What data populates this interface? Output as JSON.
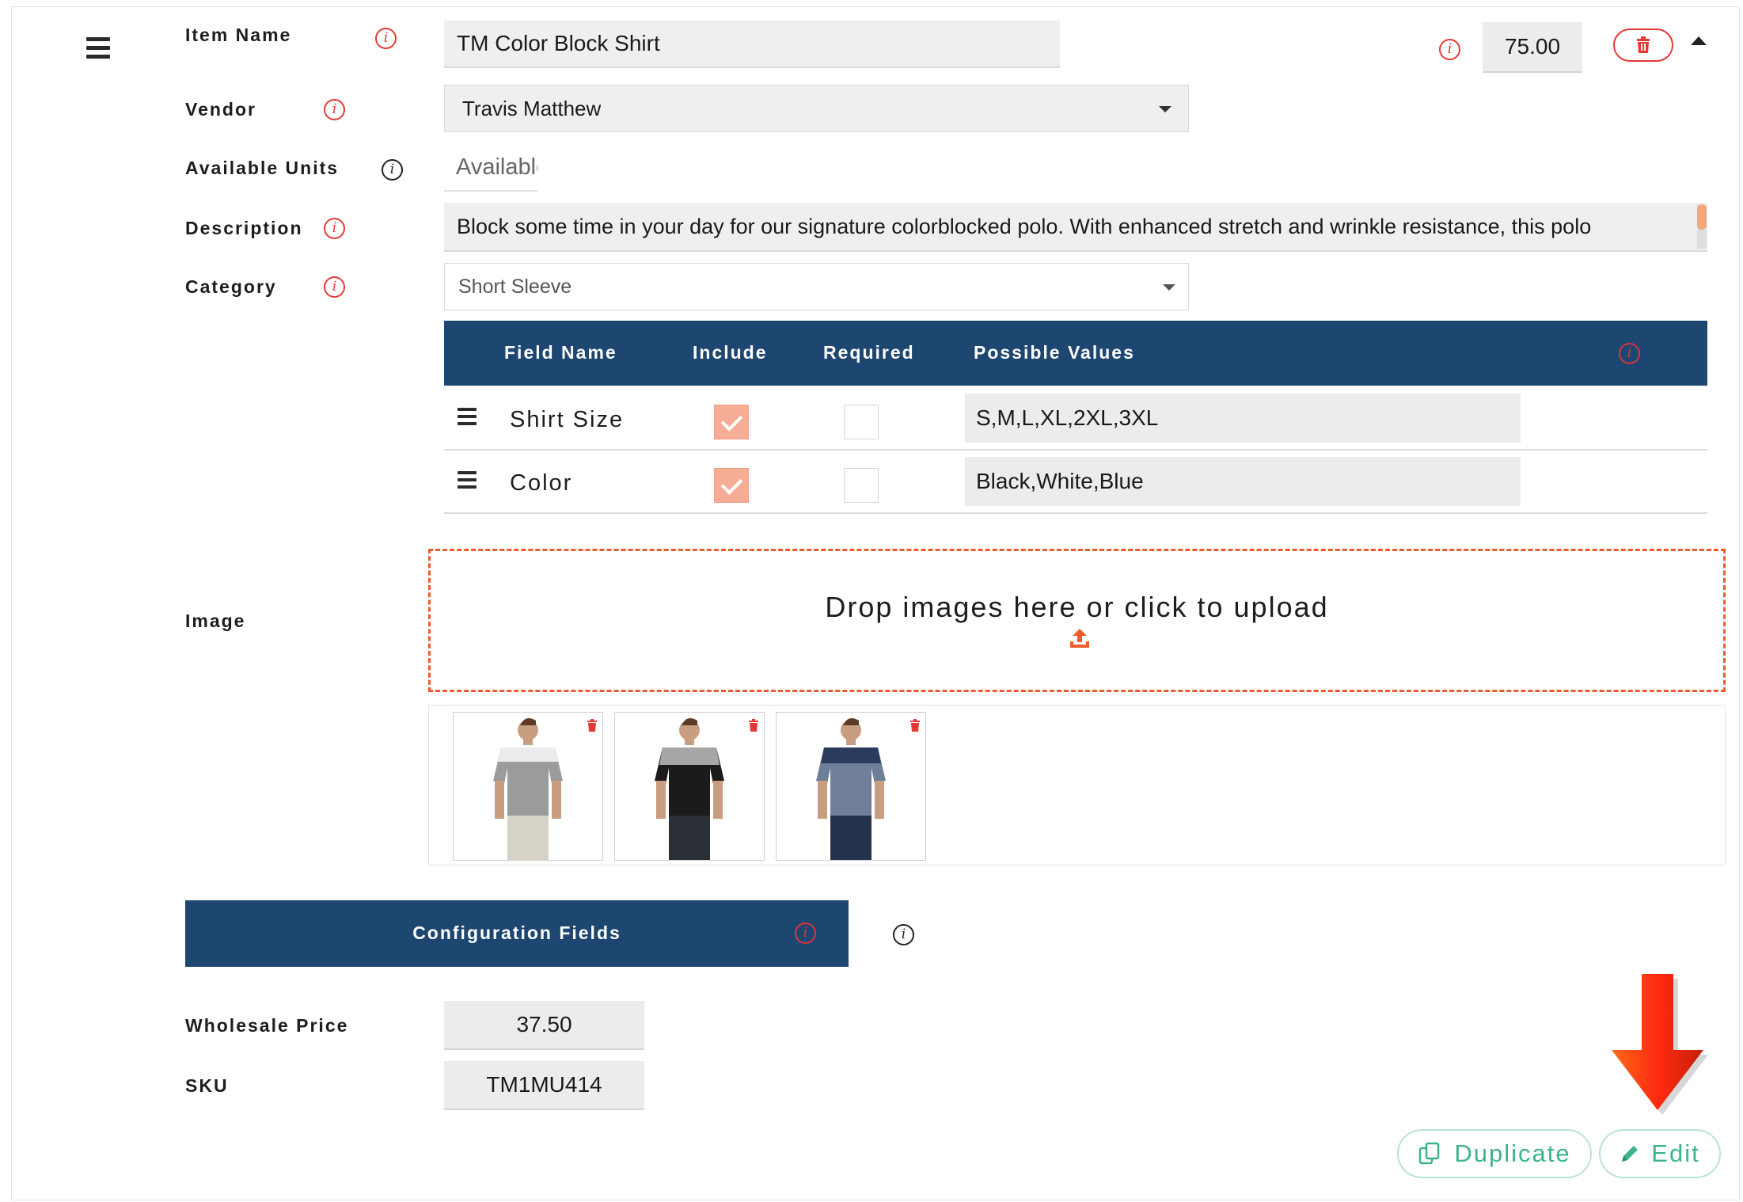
{
  "form": {
    "item_name_label": "Item Name",
    "item_name_value": "TM Color Block Shirt",
    "price_value": "75.00",
    "vendor_label": "Vendor",
    "vendor_value": "Travis Matthew",
    "units_label": "Available Units",
    "units_placeholder": "Available",
    "description_label": "Description",
    "description_value": "Block some time in your day for our signature colorblocked polo. With enhanced stretch and wrinkle resistance, this polo",
    "category_label": "Category",
    "category_value": "Short Sleeve",
    "image_label": "Image"
  },
  "fields_table": {
    "headers": [
      "Field Name",
      "Include",
      "Required",
      "Possible Values"
    ],
    "rows": [
      {
        "name": "Shirt Size",
        "include": true,
        "required": false,
        "values": "S,M,L,XL,2XL,3XL"
      },
      {
        "name": "Color",
        "include": true,
        "required": false,
        "values": "Black,White,Blue"
      }
    ]
  },
  "upload": {
    "drop_text": "Drop images here or click to upload"
  },
  "gallery": {
    "images": [
      {
        "name": "white-gray-shirt",
        "top_color": "#e9e9e9",
        "bottom_color": "#9b9b9b"
      },
      {
        "name": "gray-black-shirt",
        "top_color": "#a6a6a6",
        "bottom_color": "#1b1b1b"
      },
      {
        "name": "navy-blue-shirt",
        "top_color": "#2a3b5e",
        "bottom_color": "#6f7f99"
      }
    ]
  },
  "config": {
    "title": "Configuration Fields",
    "wholesale_label": "Wholesale Price",
    "wholesale_value": "37.50",
    "sku_label": "SKU",
    "sku_value": "TM1MU414"
  },
  "actions": {
    "duplicate_label": "Duplicate",
    "edit_label": "Edit"
  },
  "colors": {
    "header_navy": "#1d4670",
    "accent_orange": "#ee5b2d",
    "alert_red": "#e53935",
    "action_green": "#3cb48a",
    "checkbox_salmon": "#f6ad96"
  }
}
